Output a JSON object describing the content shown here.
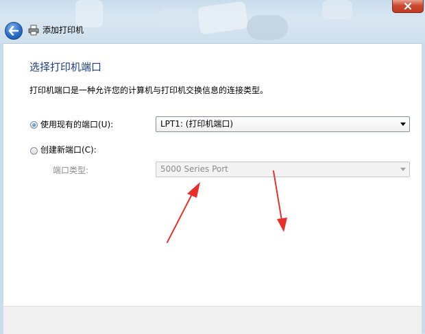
{
  "window": {
    "title": "添加打印机"
  },
  "page": {
    "heading": "选择打印机端口",
    "description": "打印机端口是一种允许您的计算机与打印机交换信息的连接类型。"
  },
  "options": {
    "existing_port_label": "使用现有的端口(U):",
    "existing_port_selected": true,
    "existing_port_value": "LPT1: (打印机端口)",
    "new_port_label": "创建新端口(C):",
    "new_port_selected": false,
    "port_type_label": "端口类型:",
    "port_type_value": "5000 Series Port"
  },
  "colors": {
    "heading": "#1e3e87",
    "annotation_arrow": "#e8302a",
    "close_button": "#c23a22"
  },
  "icons": {
    "back": "back-arrow-icon",
    "printer": "printer-icon",
    "close": "close-icon"
  }
}
